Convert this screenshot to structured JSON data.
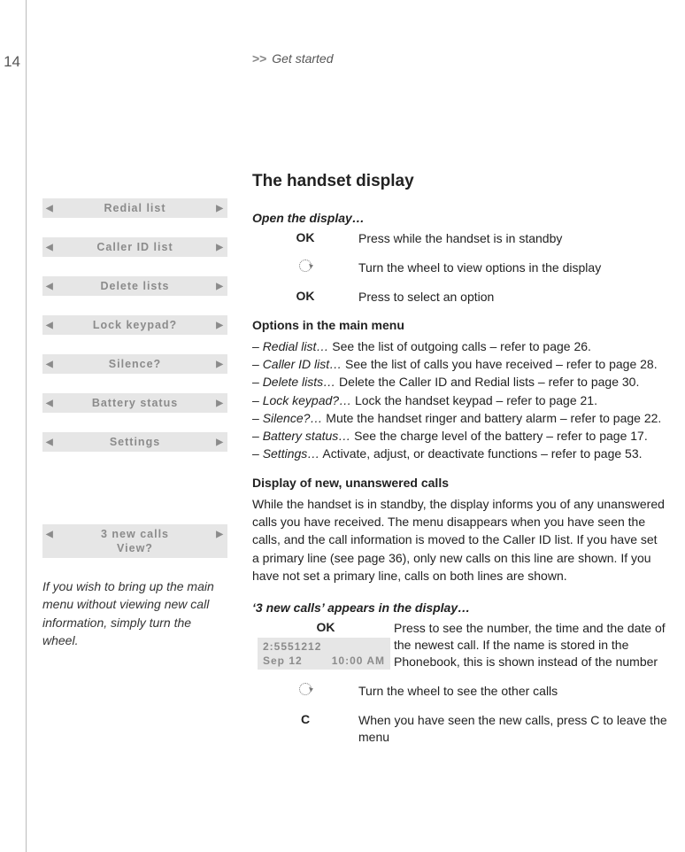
{
  "page_number": "14",
  "breadcrumb": {
    "prefix": ">>",
    "label": "Get started"
  },
  "section_title": "The handset display",
  "open_display_heading": "Open the display…",
  "steps_open": [
    {
      "key": "OK",
      "bold": true,
      "desc": "Press while the handset is in standby"
    },
    {
      "key": "wheel",
      "bold": false,
      "desc": "Turn the wheel to view options in the display"
    },
    {
      "key": "OK",
      "bold": true,
      "desc": "Press to select an option"
    }
  ],
  "options_heading": "Options in the main menu",
  "options": [
    {
      "label": "Redial list…",
      "desc": "See the list of outgoing calls – refer to page 26."
    },
    {
      "label": "Caller ID list…",
      "desc": "See the list of calls you have received – refer to page 28."
    },
    {
      "label": "Delete lists…",
      "desc": "Delete the Caller ID and Redial lists – refer to page 30."
    },
    {
      "label": "Lock keypad?…",
      "desc": "Lock the handset keypad – refer to page 21."
    },
    {
      "label": "Silence?…",
      "desc": "Mute the handset ringer and battery alarm – refer to page 22."
    },
    {
      "label": "Battery status…",
      "desc": "See the charge level of the battery – refer to page 17."
    },
    {
      "label": "Settings…",
      "desc": "Activate, adjust, or deactivate functions – refer to page 53."
    }
  ],
  "unanswered_heading": "Display of new, unanswered calls",
  "unanswered_paragraph": "While the handset is in standby, the display informs you of any unanswered calls you have received. The menu disappears when you have seen the calls, and the call information is moved to the Caller ID list. If you have set a primary line (see page 36), only new calls on this line are shown. If you have not set a primary line, calls on both lines are shown.",
  "three_new_heading": "‘3 new calls’ appears in the display…",
  "three_new_rows": {
    "ok_key": "OK",
    "ok_desc": "Press to see the number, the time and the date of the newest call. If the name is stored in the Phonebook, this is shown instead of the number",
    "detail_number": "2:5551212",
    "detail_date": "Sep 12",
    "detail_time": "10:00 AM",
    "wheel_desc": "Turn the wheel to see the other calls",
    "c_key": "C",
    "c_desc": "When you have seen the new calls, press C to leave the menu"
  },
  "sidebar_menu": [
    "Redial list",
    "Caller ID list",
    "Delete lists",
    "Lock keypad?",
    "Silence?",
    "Battery status",
    "Settings"
  ],
  "sidebar_newcalls": {
    "line1": "3 new calls",
    "line2": "View?"
  },
  "sidebar_note": "If you wish to bring up the main menu without viewing new call information, simply turn the wheel."
}
